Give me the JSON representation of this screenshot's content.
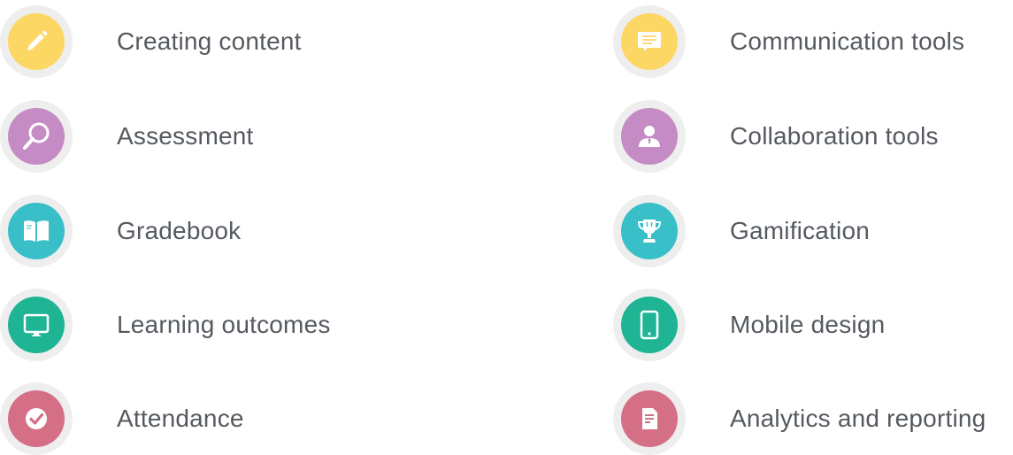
{
  "features": {
    "left": [
      {
        "label": "Creating content",
        "icon": "pencil-icon",
        "color": "#fdd764"
      },
      {
        "label": "Assessment",
        "icon": "magnifier-icon",
        "color": "#c58bc4"
      },
      {
        "label": "Gradebook",
        "icon": "book-icon",
        "color": "#38bfc8"
      },
      {
        "label": "Learning outcomes",
        "icon": "monitor-icon",
        "color": "#1eb494"
      },
      {
        "label": "Attendance",
        "icon": "checkmark-icon",
        "color": "#d56f86"
      }
    ],
    "right": [
      {
        "label": "Communication tools",
        "icon": "chat-bubble-icon",
        "color": "#fdd764"
      },
      {
        "label": "Collaboration tools",
        "icon": "person-icon",
        "color": "#c58bc4"
      },
      {
        "label": "Gamification",
        "icon": "trophy-icon",
        "color": "#38bfc8"
      },
      {
        "label": "Mobile design",
        "icon": "smartphone-icon",
        "color": "#1eb494"
      },
      {
        "label": "Analytics and reporting",
        "icon": "document-icon",
        "color": "#d56f86"
      }
    ]
  }
}
